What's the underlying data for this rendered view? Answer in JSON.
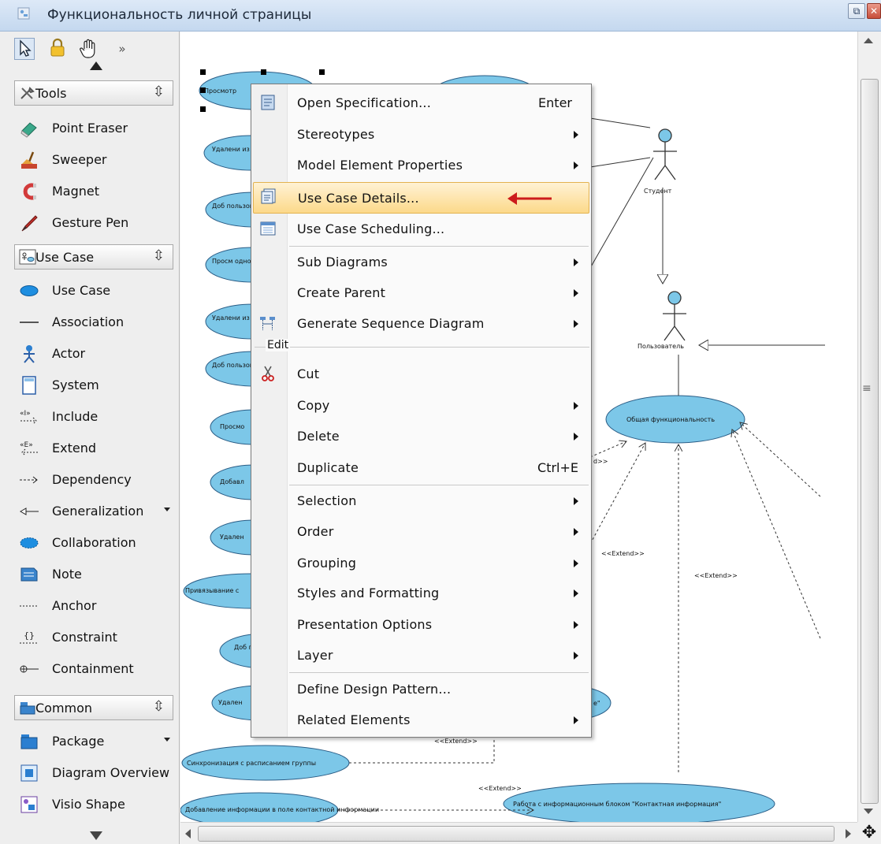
{
  "window": {
    "title": "Функциональность личной страницы"
  },
  "palette": {
    "toolbar": [
      "select-arrow",
      "lock",
      "hand-pan",
      "more"
    ],
    "groups": [
      {
        "header": "Tools",
        "items": [
          {
            "label": "Point Eraser",
            "icon": "eraser-icon"
          },
          {
            "label": "Sweeper",
            "icon": "sweeper-icon"
          },
          {
            "label": "Magnet",
            "icon": "magnet-icon"
          },
          {
            "label": "Gesture Pen",
            "icon": "pen-icon"
          }
        ]
      },
      {
        "header": "Use Case",
        "items": [
          {
            "label": "Use Case",
            "icon": "ellipse-icon"
          },
          {
            "label": "Association",
            "icon": "line-icon"
          },
          {
            "label": "Actor",
            "icon": "actor-icon"
          },
          {
            "label": "System",
            "icon": "system-icon"
          },
          {
            "label": "Include",
            "icon": "include-icon"
          },
          {
            "label": "Extend",
            "icon": "extend-icon"
          },
          {
            "label": "Dependency",
            "icon": "dependency-icon"
          },
          {
            "label": "Generalization",
            "icon": "generalization-icon"
          },
          {
            "label": "Collaboration",
            "icon": "collaboration-icon"
          },
          {
            "label": "Note",
            "icon": "note-icon"
          },
          {
            "label": "Anchor",
            "icon": "anchor-icon"
          },
          {
            "label": "Constraint",
            "icon": "constraint-icon"
          },
          {
            "label": "Containment",
            "icon": "containment-icon"
          }
        ]
      },
      {
        "header": "Common",
        "items": [
          {
            "label": "Package",
            "icon": "package-icon"
          },
          {
            "label": "Diagram Overview",
            "icon": "diagram-overview-icon"
          },
          {
            "label": "Visio Shape",
            "icon": "visio-shape-icon"
          }
        ]
      }
    ]
  },
  "diagram": {
    "actors": [
      "Студент",
      "Пользователь"
    ],
    "usecases": [
      "Просмотр",
      "Удалени из сп",
      "Доб пользоват",
      "Просм однок",
      "Удалени из",
      "Доб пользоват",
      "Просмо",
      "Добавл",
      "Удален",
      "Привязывание с",
      "Доб п",
      "Удален",
      "Синхронизация с расписанием группы",
      "Добавление информации в поле контактной информации",
      "Работа с информационным блоком \"Контактная информация\"",
      "Общая функциональность"
    ],
    "labels": {
      "extend": "<<Extend>>",
      "extend_partial": "d>>",
      "quote_partial": "e\""
    }
  },
  "context_menu": {
    "items": [
      {
        "label": "Open Specification...",
        "shortcut": "Enter",
        "icon": "specification-icon"
      },
      {
        "label": "Stereotypes",
        "submenu": true
      },
      {
        "label": "Model Element Properties",
        "submenu": true
      },
      {
        "label": "Use Case Details...",
        "icon": "use-case-details-icon",
        "highlighted": true
      },
      {
        "label": "Use Case Scheduling...",
        "icon": "scheduling-icon"
      },
      {
        "label": "Sub Diagrams",
        "submenu": true
      },
      {
        "label": "Create Parent",
        "submenu": true
      },
      {
        "label": "Generate Sequence Diagram",
        "submenu": true,
        "icon": "sequence-diagram-icon"
      },
      {
        "label": "Cut",
        "icon": "scissors-icon"
      },
      {
        "label": "Copy",
        "submenu": true
      },
      {
        "label": "Delete",
        "submenu": true
      },
      {
        "label": "Duplicate",
        "shortcut": "Ctrl+E"
      },
      {
        "label": "Selection",
        "submenu": true
      },
      {
        "label": "Order",
        "submenu": true
      },
      {
        "label": "Grouping",
        "submenu": true
      },
      {
        "label": "Styles and Formatting",
        "submenu": true
      },
      {
        "label": "Presentation Options",
        "submenu": true
      },
      {
        "label": "Layer",
        "submenu": true
      },
      {
        "label": "Define Design Pattern..."
      },
      {
        "label": "Related Elements",
        "submenu": true
      }
    ],
    "edit_group_label": "Edit"
  },
  "colors": {
    "usecase_fill": "#7cc7e8",
    "usecase_stroke": "#2a5d86",
    "highlight_arrow": "#cc1b1b",
    "menu_highlight": "#fcd98a"
  }
}
